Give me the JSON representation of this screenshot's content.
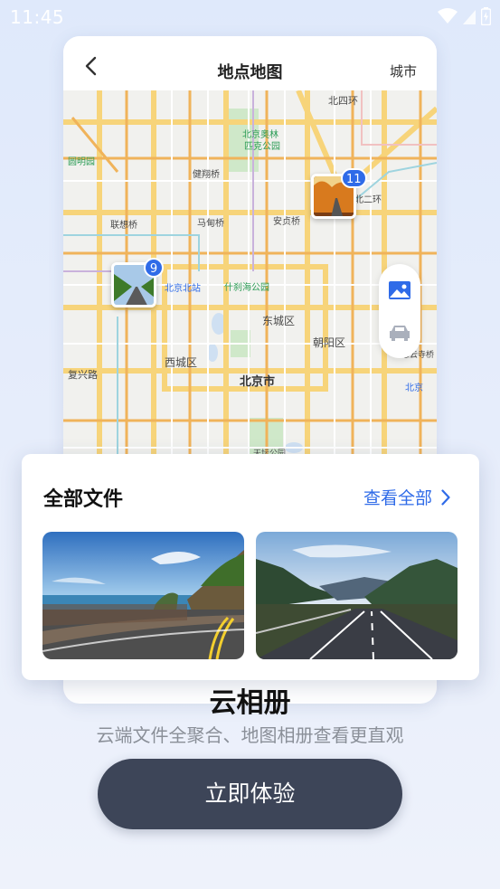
{
  "status_bar": {
    "time": "11:45"
  },
  "phone": {
    "title": "地点地图",
    "right_label": "城市",
    "map": {
      "labels": {
        "beisihuan": "北四环",
        "beijing_olympic": "北京奥林",
        "olympic_park": "匹克公园",
        "jiande_bridge": "健翔桥",
        "beierhuan": "北二环",
        "lianxiang_bridge": "联想桥",
        "madian_bridge": "马甸桥",
        "anzhen_bridge": "安贞桥",
        "beijing_north_station": "北京北站",
        "shichahai": "什刹海公园",
        "dongcheng": "东城区",
        "chaoyang": "朝阳区",
        "xicheng": "西城区",
        "fuxing_road": "复兴路",
        "beijing_city": "北京市",
        "tiantan": "天坛公园",
        "yuanmingyuan": "圆明园",
        "jinsong_bridge": "慧云寺桥",
        "beijing_station": "北京"
      },
      "pins": [
        {
          "count": "11"
        },
        {
          "count": "9"
        }
      ]
    }
  },
  "files": {
    "title": "全部文件",
    "view_all": "查看全部"
  },
  "main_title": "云相册",
  "subtitle": "云端文件全聚合、地图相册查看更直观",
  "cta": "立即体验",
  "colors": {
    "accent": "#2f6be8",
    "button": "#3d4558",
    "background": "#e3ebfb"
  }
}
